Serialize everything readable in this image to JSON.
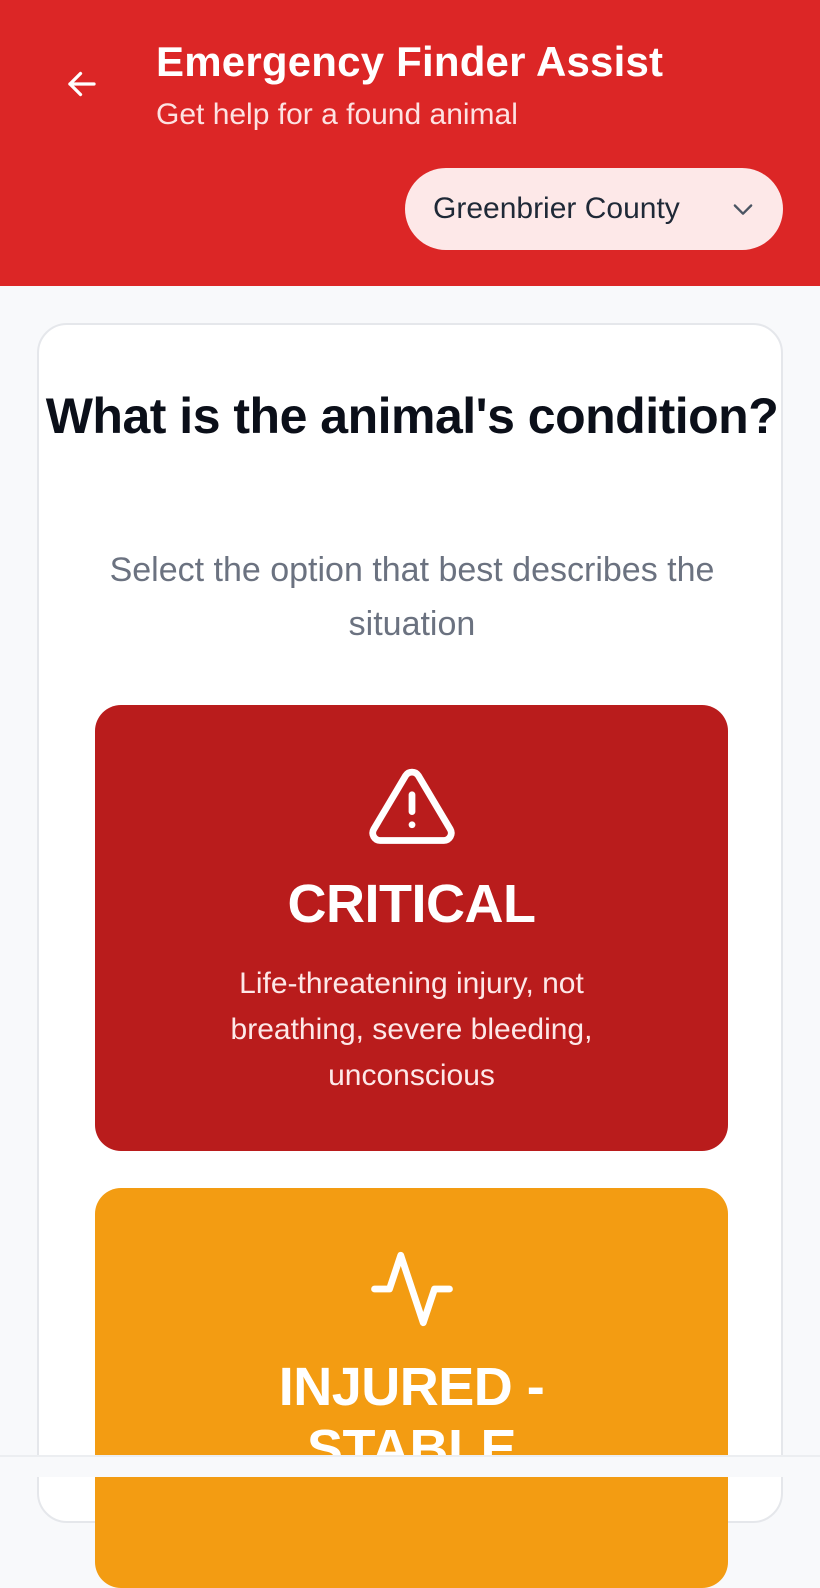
{
  "header": {
    "title": "Emergency Finder Assist",
    "subtitle": "Get help for a found animal",
    "back_icon": "arrow-left-icon",
    "county_select": {
      "value": "Greenbrier County",
      "icon": "chevron-down-icon"
    }
  },
  "main": {
    "question": "What is the animal's condition?",
    "hint": "Select the option that best describes the situation",
    "options": [
      {
        "title": "CRITICAL",
        "description": "Life-threatening injury, not breathing, severe bleeding, unconscious",
        "icon": "warning-triangle-icon",
        "color": "#b91c1c"
      },
      {
        "title": "INJURED - STABLE",
        "icon": "pulse-icon",
        "color": "#f39c12"
      }
    ]
  },
  "colors": {
    "header_bg": "#dc2626",
    "page_bg": "#f8f9fb",
    "select_bg": "#fde8e8"
  }
}
